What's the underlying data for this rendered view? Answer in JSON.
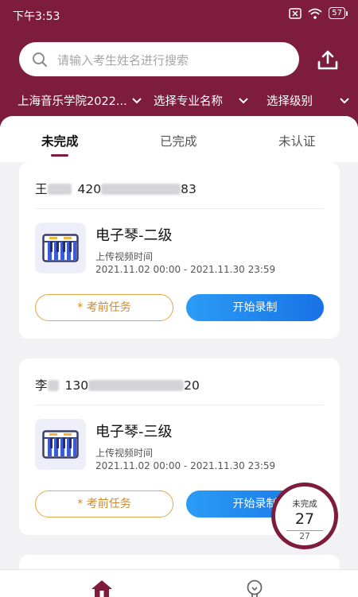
{
  "status_bar": {
    "time": "下午3:53",
    "battery": "57"
  },
  "search": {
    "placeholder": "请输入考生姓名进行搜索"
  },
  "filters": {
    "school": "上海音乐学院2022...",
    "major": "选择专业名称",
    "level": "选择级别"
  },
  "tabs": [
    {
      "label": "未完成"
    },
    {
      "label": "已完成"
    },
    {
      "label": "未认证"
    }
  ],
  "cards": [
    {
      "student_name": "王",
      "id_prefix": "420",
      "id_suffix": "83",
      "exam_name": "电子琴-二级",
      "upload_label": "上传视频时间",
      "upload_time": "2021.11.02 00:00 - 2021.11.30 23:59",
      "pre_task_label": "* 考前任务",
      "record_label": "开始录制"
    },
    {
      "student_name": "李",
      "id_prefix": "130",
      "id_suffix": "20",
      "exam_name": "电子琴-三级",
      "upload_label": "上传视频时间",
      "upload_time": "2021.11.02 00:00 - 2021.11.30 23:59",
      "pre_task_label": "* 考前任务",
      "record_label": "开始录制"
    }
  ],
  "progress_badge": {
    "label": "未完成",
    "count": "27",
    "total": "27"
  },
  "icons": [
    "search-icon",
    "upload-icon",
    "chevron-down-icon",
    "keyboard-icon",
    "home-icon",
    "lightbulb-icon",
    "wifi-icon",
    "battery-icon",
    "mute-icon"
  ],
  "colors": {
    "brand": "#7e1c3d",
    "primary_button": "#1f86ee",
    "outline_button": "#e3a54a"
  }
}
